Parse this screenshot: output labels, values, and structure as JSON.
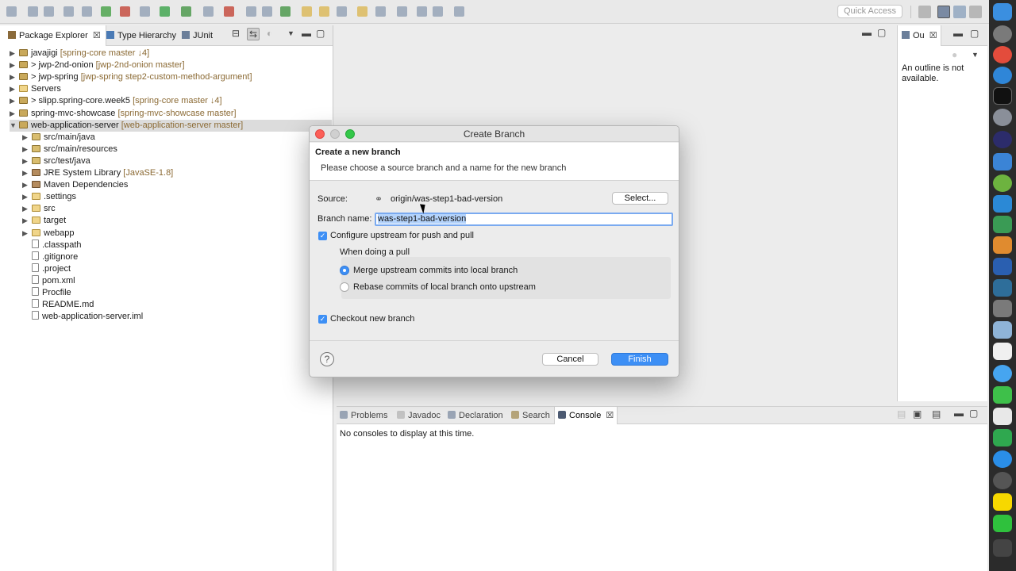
{
  "toolbar": {
    "quick_access": "Quick Access"
  },
  "package_explorer": {
    "tabs": [
      "Package Explorer",
      "Type Hierarchy",
      "JUnit"
    ],
    "tree": [
      {
        "label": "javajigi",
        "deco": "[spring-core master ↓4]",
        "prefix": "",
        "icon": "proj",
        "indent": 0,
        "expanded": false,
        "selected": false
      },
      {
        "label": "jwp-2nd-onion",
        "deco": "[jwp-2nd-onion master]",
        "prefix": "> ",
        "icon": "proj",
        "indent": 0,
        "expanded": false,
        "selected": false
      },
      {
        "label": "jwp-spring",
        "deco": "[jwp-spring step2-custom-method-argument]",
        "prefix": "> ",
        "icon": "proj",
        "indent": 0,
        "expanded": false,
        "selected": false
      },
      {
        "label": "Servers",
        "deco": "",
        "prefix": "",
        "icon": "folder",
        "indent": 0,
        "expanded": false,
        "selected": false
      },
      {
        "label": "slipp.spring-core.week5",
        "deco": "[spring-core master ↓4]",
        "prefix": "> ",
        "icon": "proj",
        "indent": 0,
        "expanded": false,
        "selected": false
      },
      {
        "label": "spring-mvc-showcase",
        "deco": "[spring-mvc-showcase master]",
        "prefix": "",
        "icon": "proj",
        "indent": 0,
        "expanded": false,
        "selected": false
      },
      {
        "label": "web-application-server",
        "deco": "[web-application-server master]",
        "prefix": "",
        "icon": "proj",
        "indent": 0,
        "expanded": true,
        "selected": true
      },
      {
        "label": "src/main/java",
        "deco": "",
        "prefix": "",
        "icon": "src",
        "indent": 1,
        "expanded": false,
        "selected": false
      },
      {
        "label": "src/main/resources",
        "deco": "",
        "prefix": "",
        "icon": "src",
        "indent": 1,
        "expanded": false,
        "selected": false
      },
      {
        "label": "src/test/java",
        "deco": "",
        "prefix": "",
        "icon": "src",
        "indent": 1,
        "expanded": false,
        "selected": false
      },
      {
        "label": "JRE System Library",
        "deco": "[JavaSE-1.8]",
        "prefix": "",
        "icon": "lib",
        "indent": 1,
        "expanded": false,
        "selected": false
      },
      {
        "label": "Maven Dependencies",
        "deco": "",
        "prefix": "",
        "icon": "lib",
        "indent": 1,
        "expanded": false,
        "selected": false
      },
      {
        "label": ".settings",
        "deco": "",
        "prefix": "",
        "icon": "folder",
        "indent": 1,
        "expanded": false,
        "selected": false
      },
      {
        "label": "src",
        "deco": "",
        "prefix": "",
        "icon": "folder",
        "indent": 1,
        "expanded": false,
        "selected": false
      },
      {
        "label": "target",
        "deco": "",
        "prefix": "",
        "icon": "folder",
        "indent": 1,
        "expanded": false,
        "selected": false
      },
      {
        "label": "webapp",
        "deco": "",
        "prefix": "",
        "icon": "folder",
        "indent": 1,
        "expanded": false,
        "selected": false
      },
      {
        "label": ".classpath",
        "deco": "",
        "prefix": "",
        "icon": "file",
        "indent": 1,
        "leaf": true,
        "selected": false
      },
      {
        "label": ".gitignore",
        "deco": "",
        "prefix": "",
        "icon": "file",
        "indent": 1,
        "leaf": true,
        "selected": false
      },
      {
        "label": ".project",
        "deco": "",
        "prefix": "",
        "icon": "file",
        "indent": 1,
        "leaf": true,
        "selected": false
      },
      {
        "label": "pom.xml",
        "deco": "",
        "prefix": "",
        "icon": "file",
        "indent": 1,
        "leaf": true,
        "selected": false
      },
      {
        "label": "Procfile",
        "deco": "",
        "prefix": "",
        "icon": "file",
        "indent": 1,
        "leaf": true,
        "selected": false
      },
      {
        "label": "README.md",
        "deco": "",
        "prefix": "",
        "icon": "file",
        "indent": 1,
        "leaf": true,
        "selected": false
      },
      {
        "label": "web-application-server.iml",
        "deco": "",
        "prefix": "",
        "icon": "file",
        "indent": 1,
        "leaf": true,
        "selected": false
      }
    ]
  },
  "outline": {
    "tab": "Ou",
    "message": "An outline is not available."
  },
  "console": {
    "tabs": [
      "Problems",
      "Javadoc",
      "Declaration",
      "Search",
      "Console"
    ],
    "message": "No consoles to display at this time."
  },
  "dialog": {
    "title": "Create Branch",
    "heading": "Create a new branch",
    "description": "Please choose a source branch and a name for the new branch",
    "source_label": "Source:",
    "source_value": "origin/was-step1-bad-version",
    "select_button": "Select...",
    "branch_name_label": "Branch name:",
    "branch_name_value": "was-step1-bad-version",
    "configure_upstream": "Configure upstream for push and pull",
    "pull_group_label": "When doing a pull",
    "merge_option": "Merge upstream commits into local branch",
    "rebase_option": "Rebase commits of local branch onto upstream",
    "checkout": "Checkout new branch",
    "cancel": "Cancel",
    "finish": "Finish",
    "help": "?"
  },
  "colors": {
    "accent": "#3d8ff5",
    "selection": "#dcdcdc",
    "decoration": "#8b6a34"
  }
}
